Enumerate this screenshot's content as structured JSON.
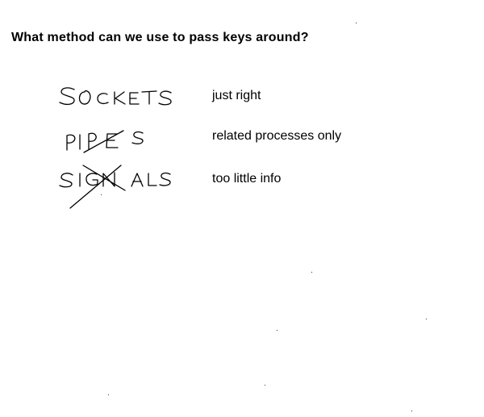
{
  "question": "What method can we use to pass keys around?",
  "methods": [
    {
      "handwritten": "SOCKETS",
      "note": "just right",
      "crossed_out": false
    },
    {
      "handwritten": "PIPES",
      "note": "related processes only",
      "crossed_out": true
    },
    {
      "handwritten": "SIGNALS",
      "note": "too little info",
      "crossed_out": true
    }
  ]
}
